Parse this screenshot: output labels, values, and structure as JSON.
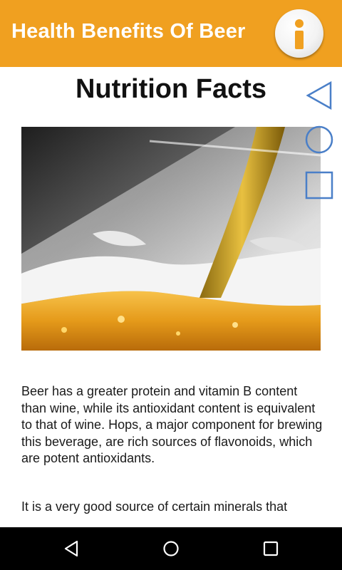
{
  "appbar": {
    "title": "Health Benefits Of Beer",
    "accent_color": "#F0A020",
    "info_icon": "info-icon"
  },
  "main": {
    "heading": "Nutrition Facts",
    "image": "beer-pouring-into-glass-photo",
    "paragraphs": [
      "Beer has a greater protein and vitamin B content than wine, while its antioxidant content is equivalent to that of wine. Hops, a major component for brewing this beverage, are rich sources of flavonoids, which are potent antioxidants.",
      "It is a very good source of certain minerals that"
    ]
  },
  "overlay_controls": {
    "icons": [
      "back-triangle-icon",
      "home-circle-icon",
      "recent-square-icon"
    ],
    "color": "#4A7FC8"
  },
  "system_nav": {
    "icons": [
      "back-icon",
      "home-icon",
      "recent-apps-icon"
    ]
  }
}
